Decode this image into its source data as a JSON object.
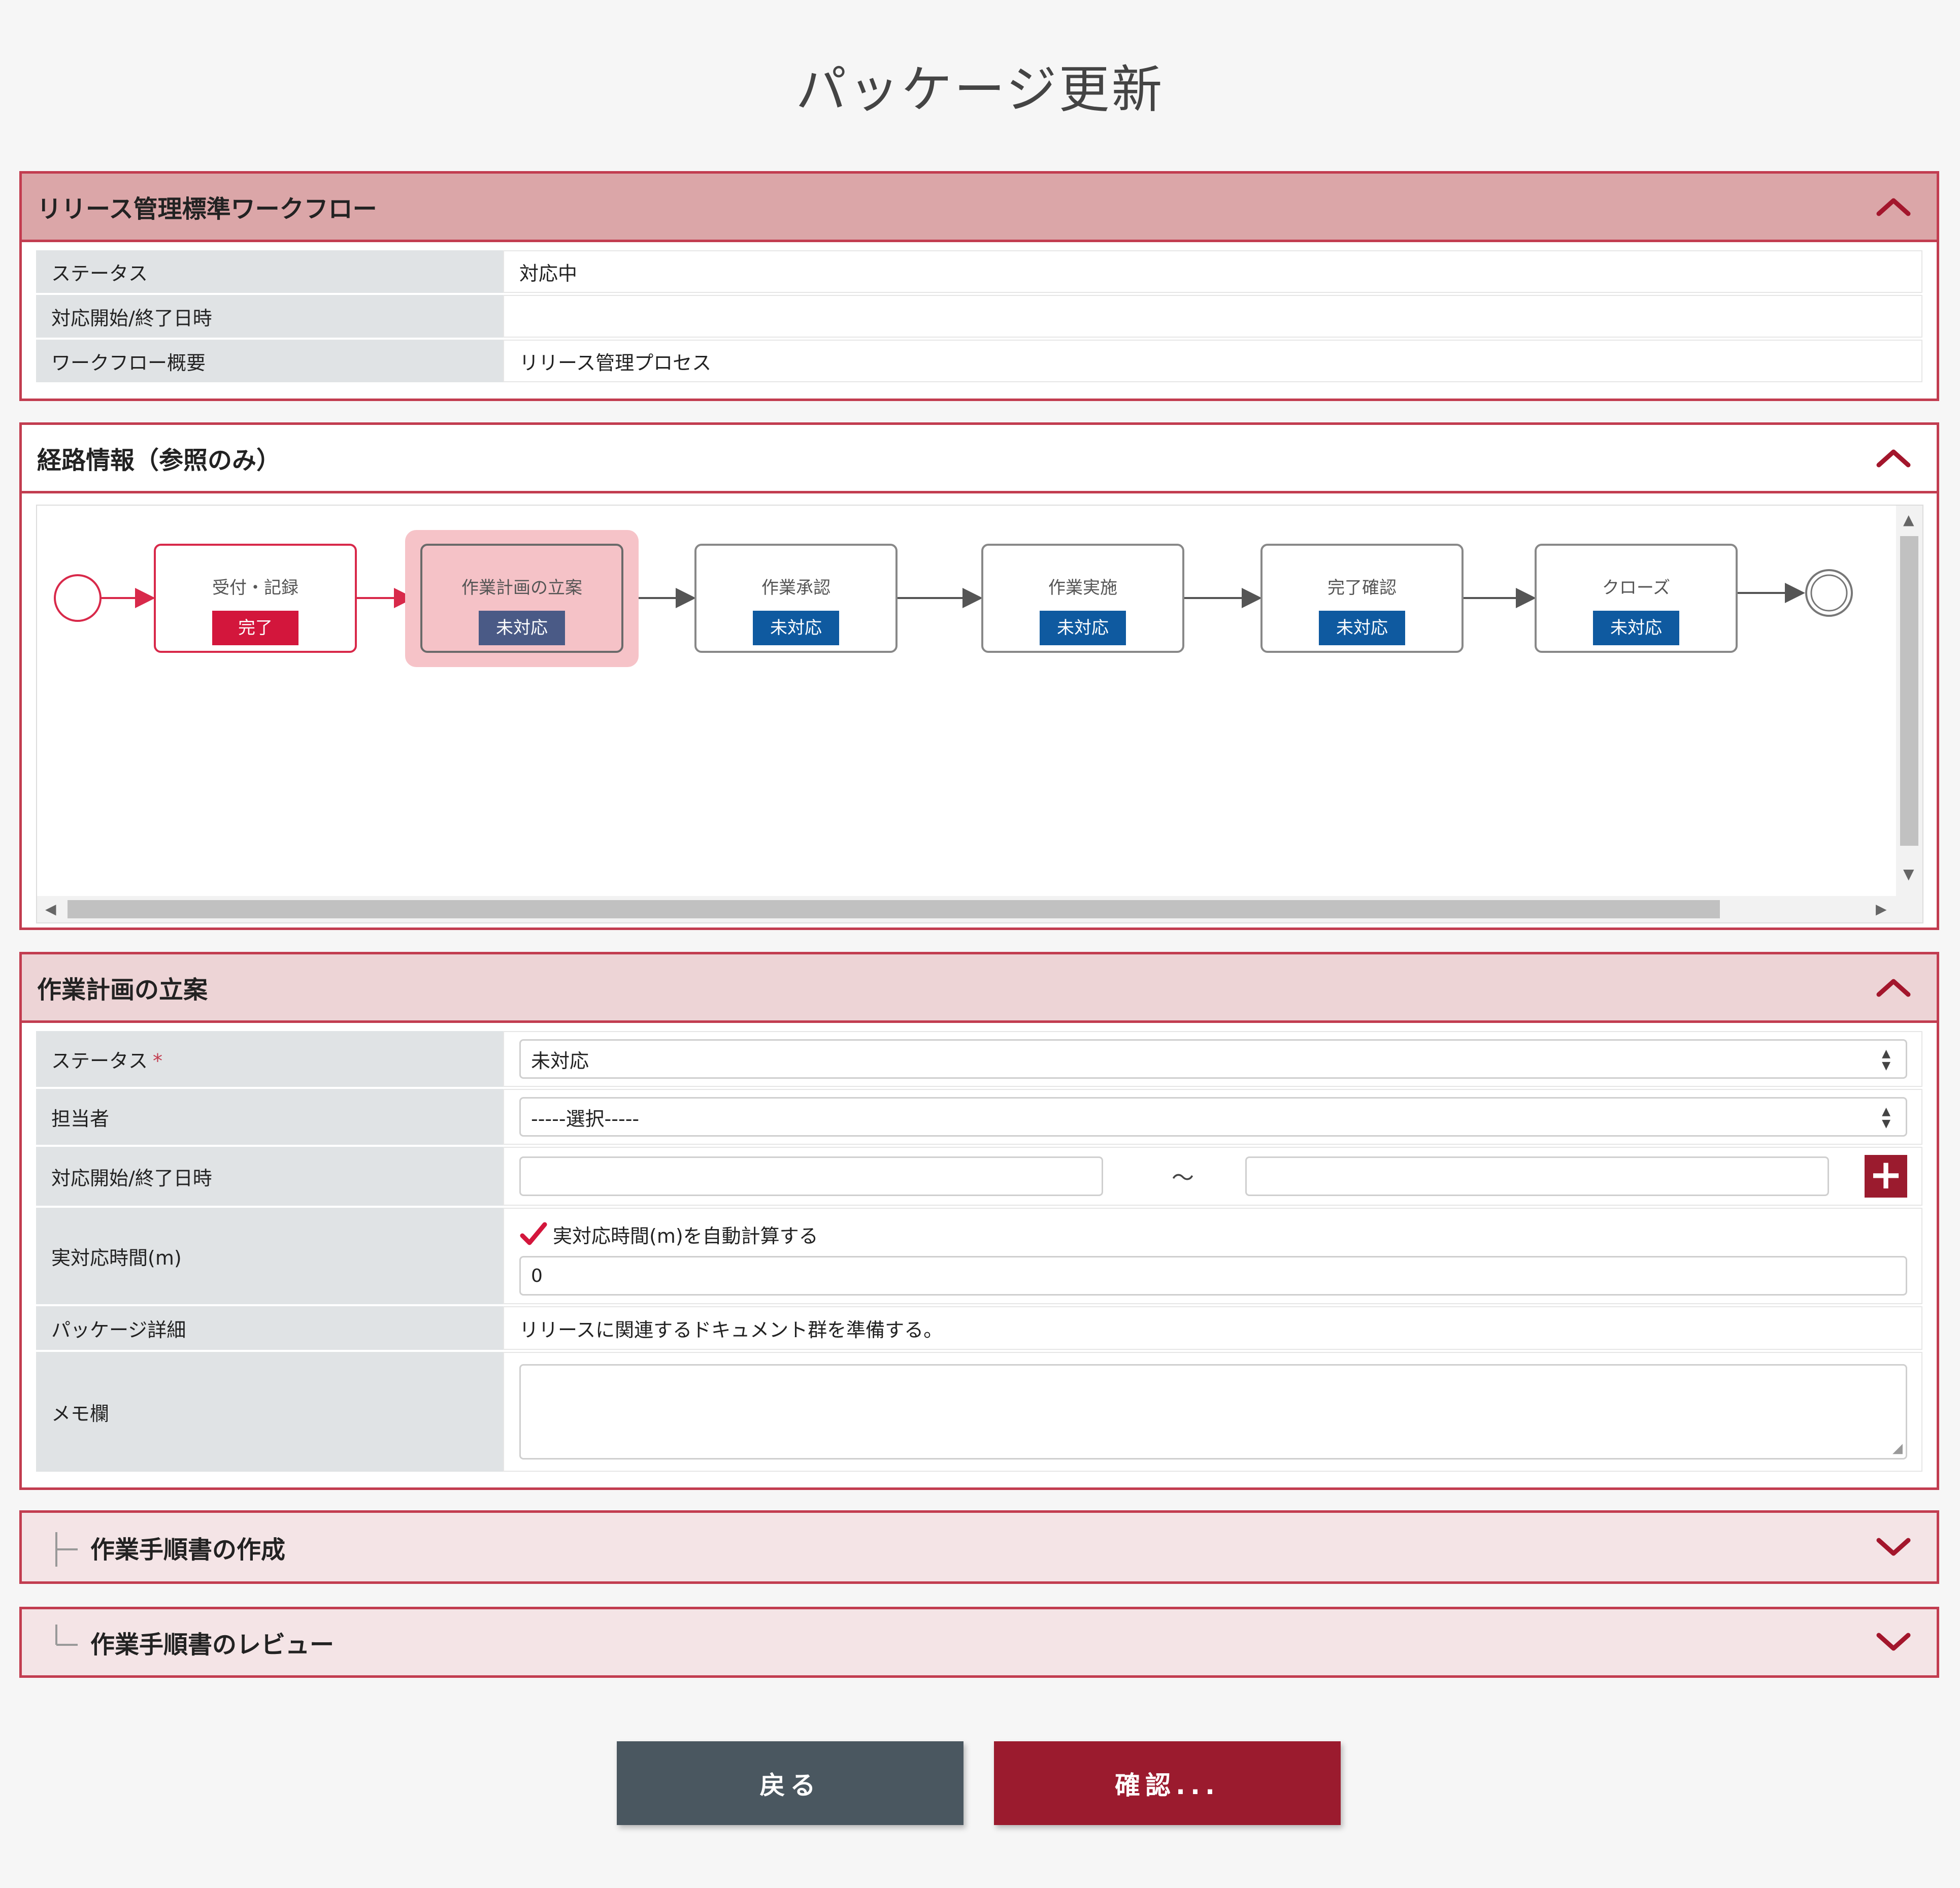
{
  "page": {
    "title": "パッケージ更新"
  },
  "workflow_panel": {
    "title": "リリース管理標準ワークフロー",
    "rows": [
      {
        "label": "ステータス",
        "value": "対応中"
      },
      {
        "label": "対応開始/終了日時",
        "value": ""
      },
      {
        "label": "ワークフロー概要",
        "value": "リリース管理プロセス"
      }
    ]
  },
  "route_panel": {
    "title": "経路情報（参照のみ）",
    "nodes": [
      {
        "name": "受付・記録",
        "status": "完了",
        "state": "done"
      },
      {
        "name": "作業計画の立案",
        "status": "未対応",
        "state": "current"
      },
      {
        "name": "作業承認",
        "status": "未対応",
        "state": "pending"
      },
      {
        "name": "作業実施",
        "status": "未対応",
        "state": "pending"
      },
      {
        "name": "完了確認",
        "status": "未対応",
        "state": "pending"
      },
      {
        "name": "クローズ",
        "status": "未対応",
        "state": "pending"
      }
    ]
  },
  "task_panel": {
    "title": "作業計画の立案",
    "status_label": "ステータス",
    "required_mark": "*",
    "status_value": "未対応",
    "assignee_label": "担当者",
    "assignee_value": "-----選択-----",
    "datetime_label": "対応開始/終了日時",
    "datetime_separator": "～",
    "plus_symbol": "+",
    "actual_time_label": "実対応時間(m)",
    "auto_calc_label": "実対応時間(m)を自動計算する",
    "auto_calc_checked": true,
    "actual_time_value": "0",
    "detail_label": "パッケージ詳細",
    "detail_value": "リリースに関連するドキュメント群を準備する。",
    "memo_label": "メモ欄",
    "memo_value": ""
  },
  "subtasks": [
    {
      "title": "作業手順書の作成"
    },
    {
      "title": "作業手順書のレビュー"
    }
  ],
  "buttons": {
    "back": "戻る",
    "confirm": "確認..."
  },
  "colors": {
    "accent": "#c23d50",
    "header_dark": "#dba6a8",
    "header_light": "#edd4d6",
    "collapsed_bg": "#f4e4e6",
    "done_badge": "#d3163c",
    "pending_badge": "#0f5aa0",
    "current_badge": "#4a5a86",
    "back_button": "#4a5760",
    "confirm_button": "#9b1b2e"
  }
}
